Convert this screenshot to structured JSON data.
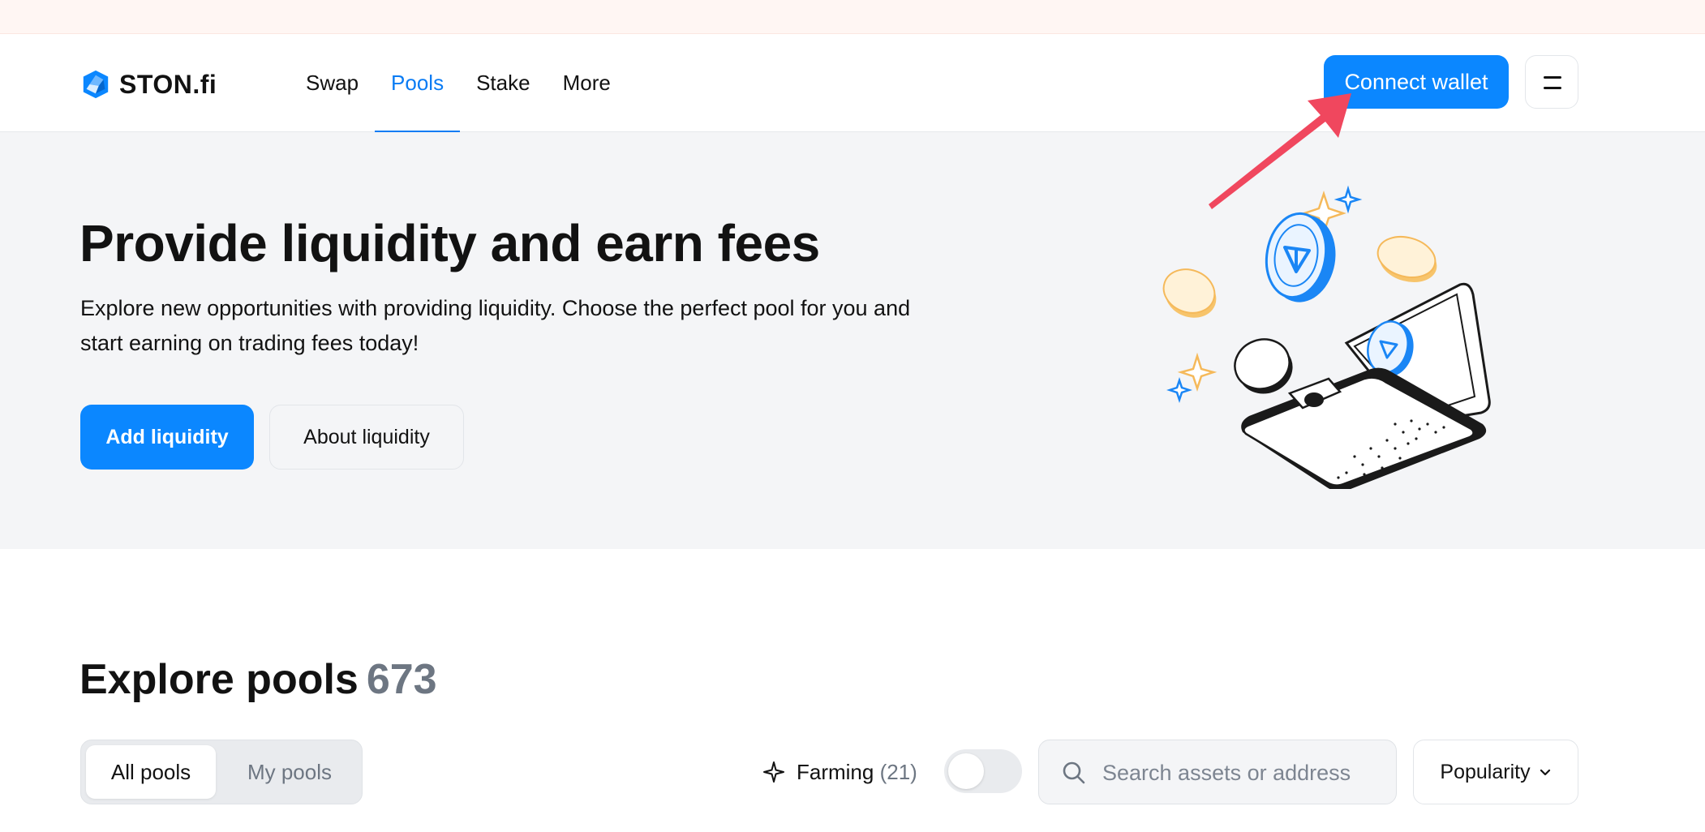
{
  "header": {
    "logo_text": "STON.fi",
    "nav": [
      {
        "label": "Swap",
        "active": false
      },
      {
        "label": "Pools",
        "active": true
      },
      {
        "label": "Stake",
        "active": false
      },
      {
        "label": "More",
        "active": false
      }
    ],
    "connect_label": "Connect wallet"
  },
  "hero": {
    "title": "Provide liquidity and earn fees",
    "description": "Explore new opportunities with providing liquidity. Choose the perfect pool for you and start earning on trading fees today!",
    "add_label": "Add liquidity",
    "about_label": "About liquidity"
  },
  "explore": {
    "title": "Explore pools",
    "count": "673",
    "tabs": {
      "all": "All pools",
      "my": "My pools"
    },
    "farming_label": "Farming",
    "farming_count": "(21)",
    "search_placeholder": "Search assets or address",
    "sort_label": "Popularity"
  },
  "colors": {
    "accent": "#0b87ff",
    "annotation": "#f0475e"
  }
}
